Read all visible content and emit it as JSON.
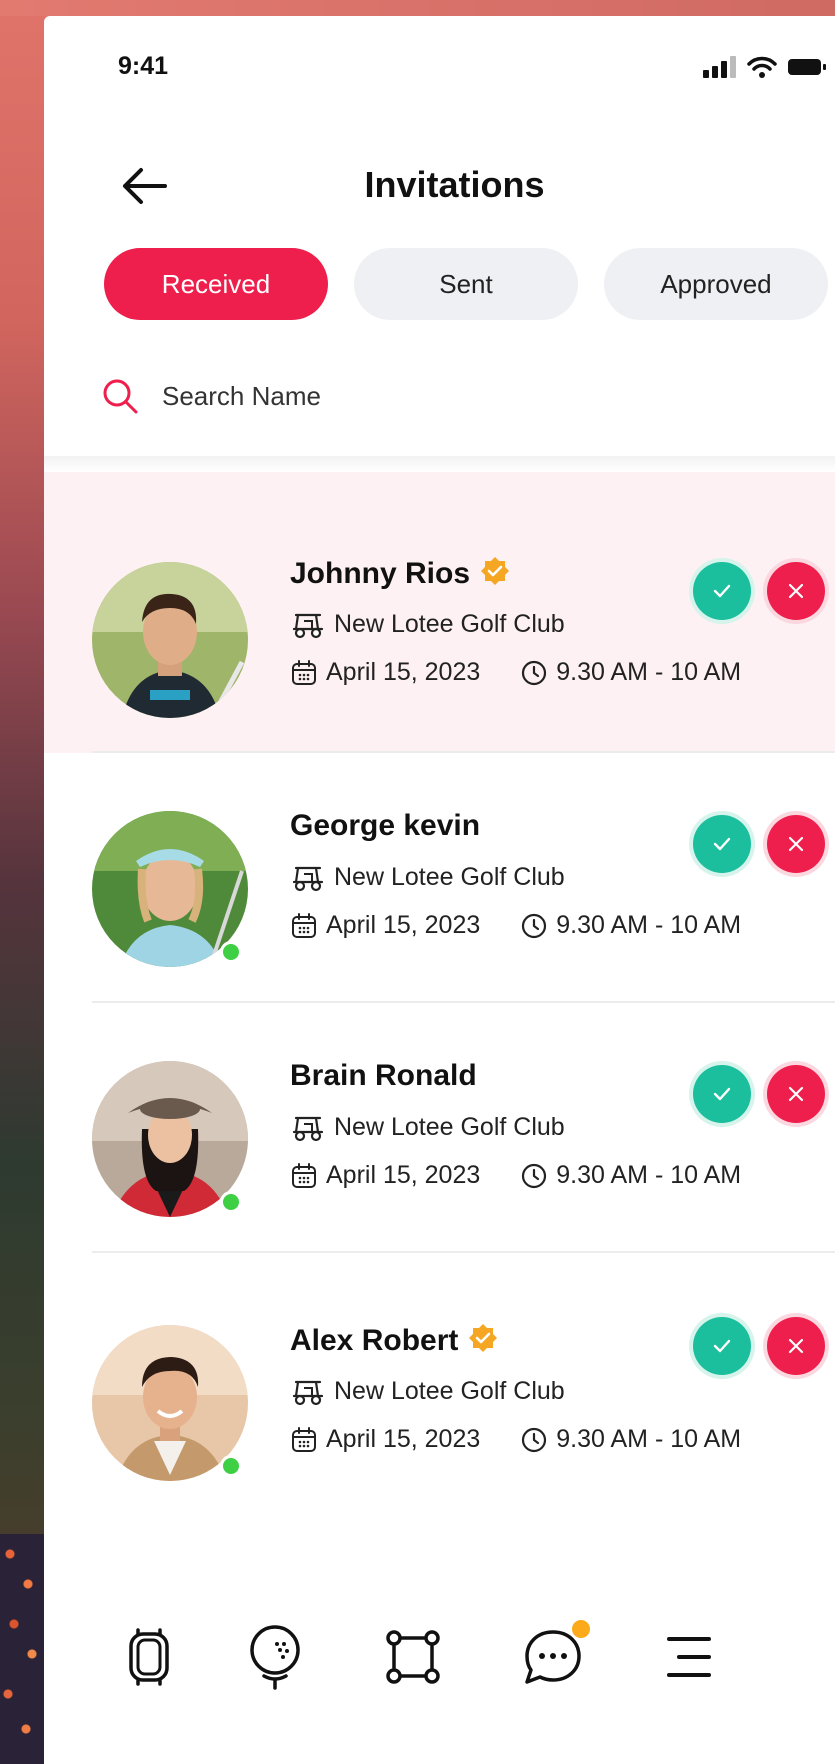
{
  "status": {
    "time": "9:41"
  },
  "header": {
    "title": "Invitations"
  },
  "tabs": [
    {
      "label": "Received",
      "active": true
    },
    {
      "label": "Sent",
      "active": false
    },
    {
      "label": "Approved",
      "active": false
    }
  ],
  "search": {
    "placeholder": "Search Name",
    "value": ""
  },
  "invitations": [
    {
      "name": "Johnny Rios",
      "verified": true,
      "online": false,
      "club": "New Lotee Golf Club",
      "date": "April 15, 2023",
      "time": "9.30 AM - 10 AM",
      "highlighted": true
    },
    {
      "name": "George kevin",
      "verified": false,
      "online": true,
      "club": "New Lotee Golf Club",
      "date": "April 15, 2023",
      "time": "9.30 AM - 10 AM",
      "highlighted": false
    },
    {
      "name": "Brain Ronald",
      "verified": false,
      "online": true,
      "club": "New Lotee Golf Club",
      "date": "April 15, 2023",
      "time": "9.30 AM - 10 AM",
      "highlighted": false
    },
    {
      "name": "Alex Robert",
      "verified": true,
      "online": true,
      "club": "New Lotee Golf Club",
      "date": "April 15, 2023",
      "time": "9.30 AM - 10 AM",
      "highlighted": false
    }
  ],
  "bottom_nav": [
    {
      "icon": "watch-icon"
    },
    {
      "icon": "golf-ball-icon"
    },
    {
      "icon": "connections-icon"
    },
    {
      "icon": "chat-icon",
      "badge": true
    },
    {
      "icon": "menu-icon"
    }
  ],
  "colors": {
    "accent": "#ee1f4c",
    "accept": "#1cbf9d",
    "online": "#3ecf45",
    "verified": "#f5a623",
    "notification": "#fbab1a",
    "highlight_row": "#fdf1f4"
  }
}
